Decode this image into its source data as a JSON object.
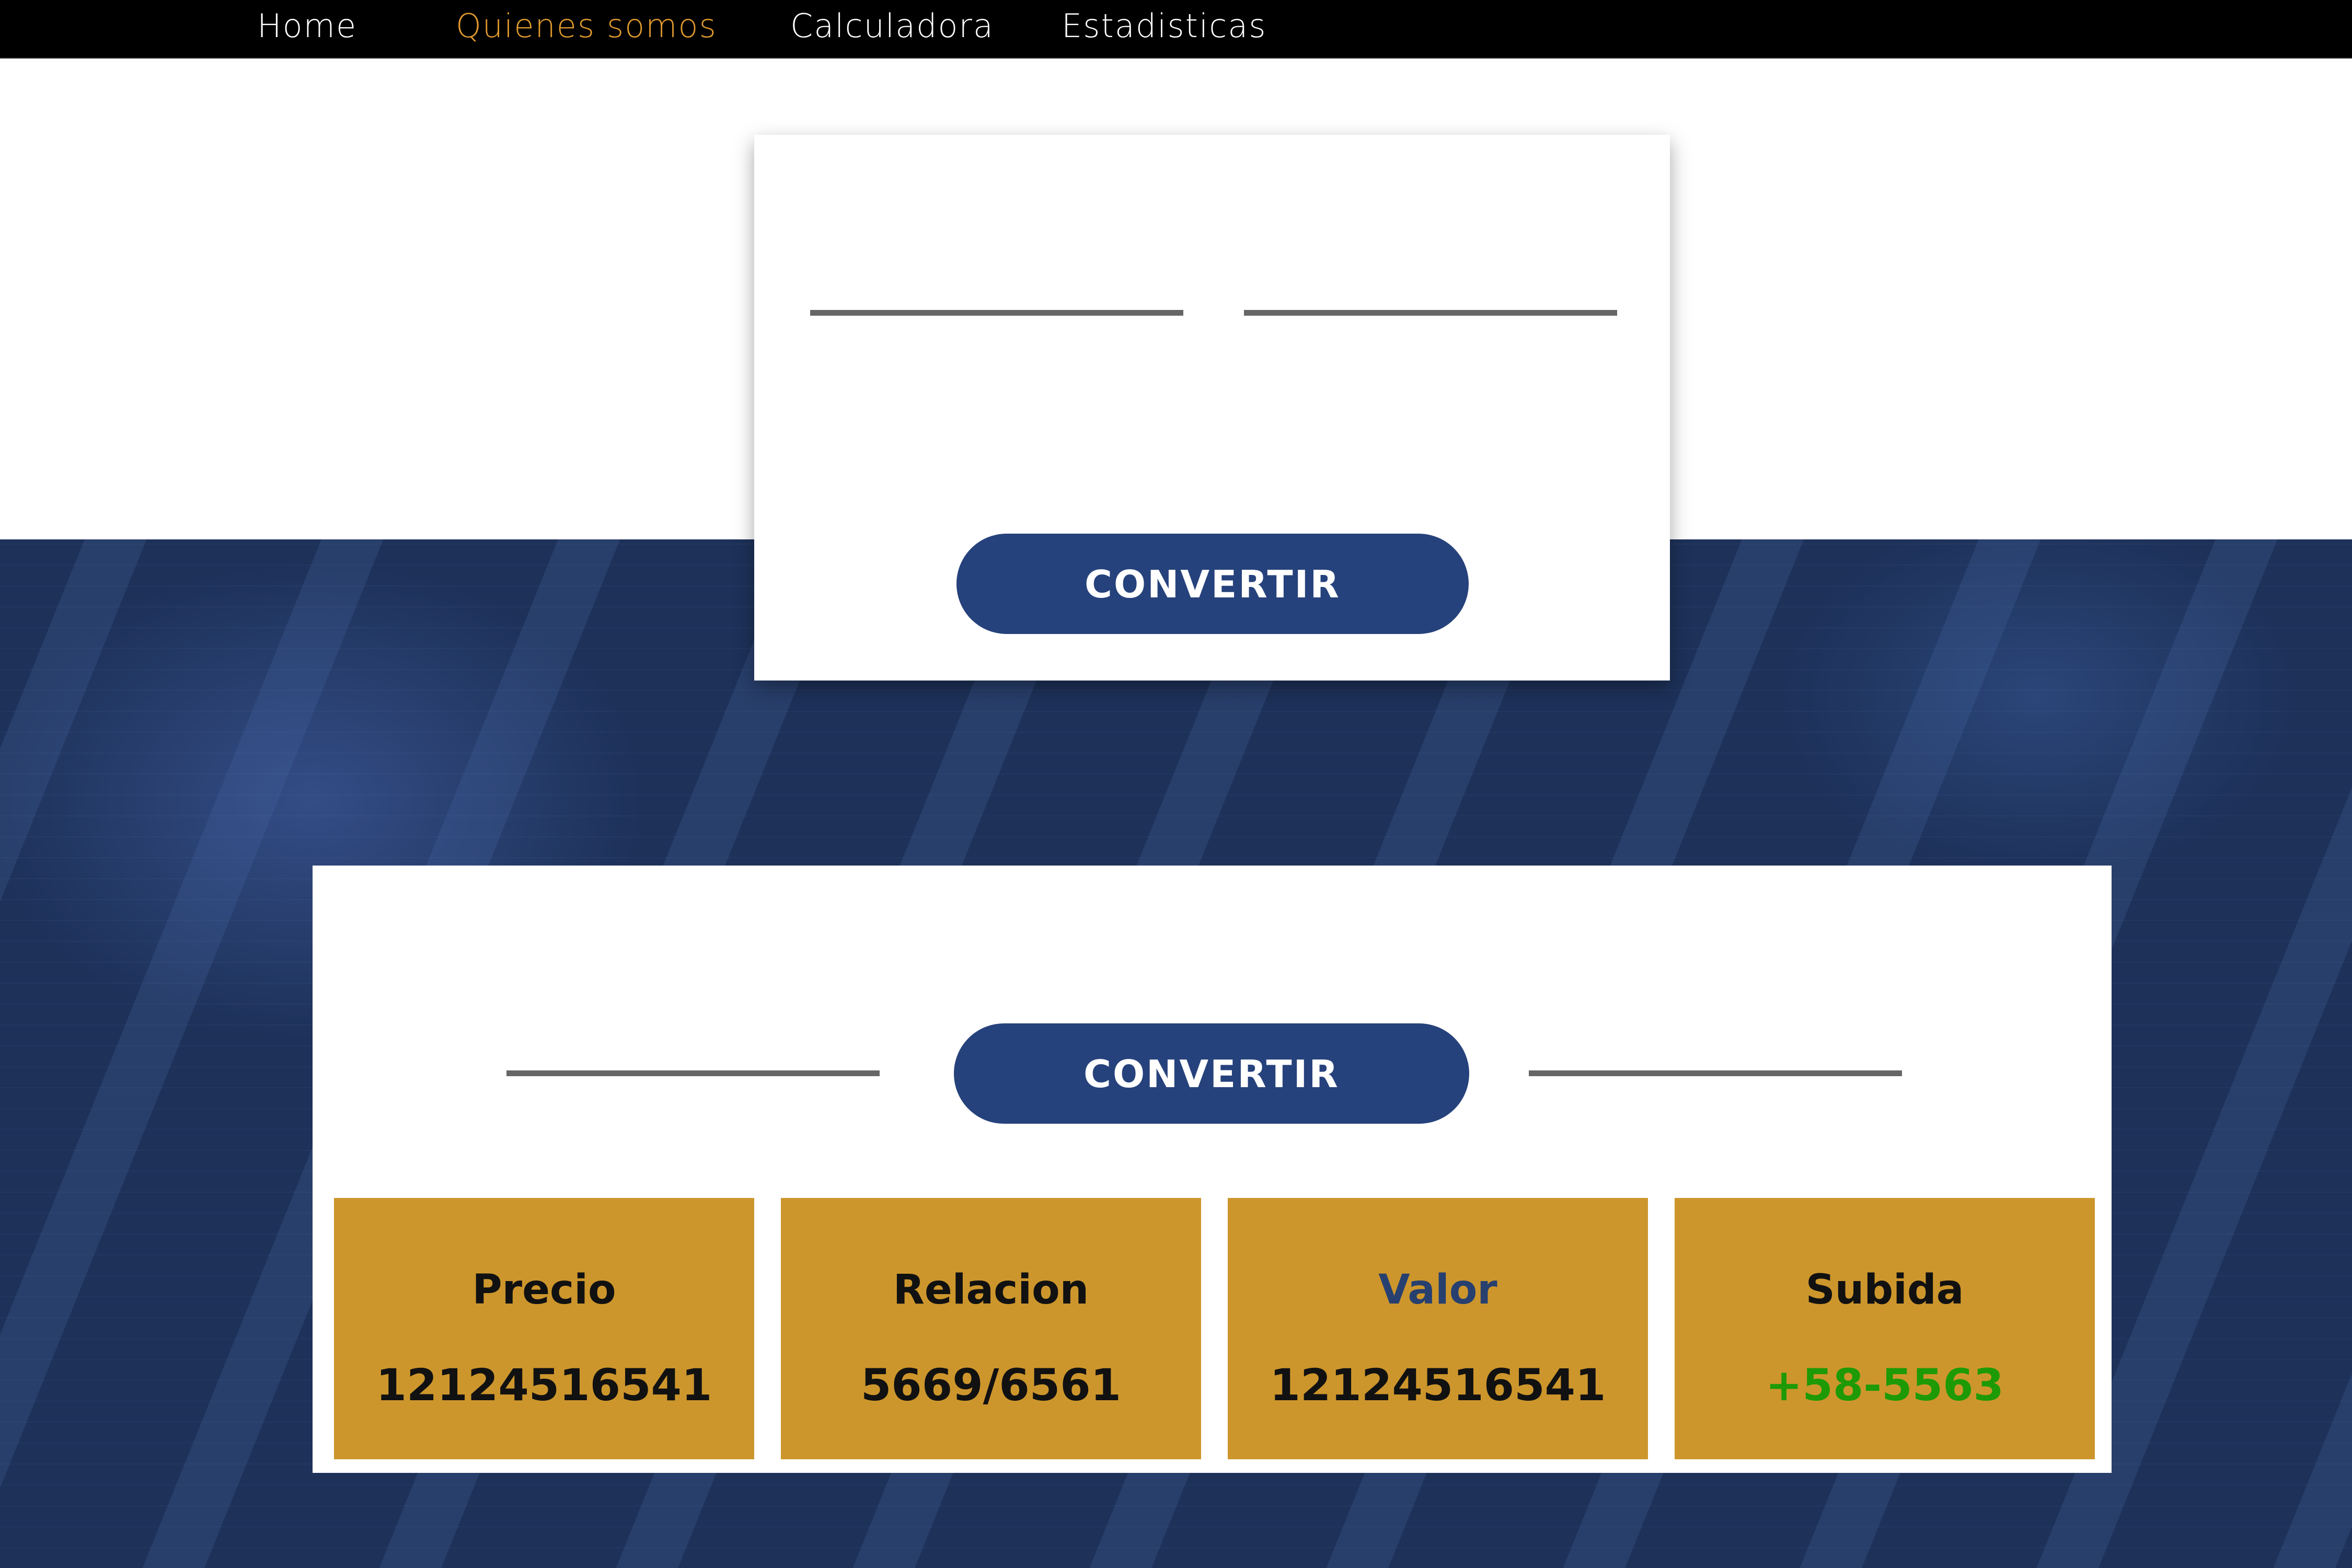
{
  "nav": {
    "items": [
      {
        "label": "Home"
      },
      {
        "label": "Quienes somos"
      },
      {
        "label": "Calculadora"
      },
      {
        "label": "Estadisticas"
      }
    ],
    "active_color": "#e09a2e"
  },
  "converter": {
    "from_value": "",
    "to_value": "",
    "button_label": "CONVERTIR"
  },
  "stats": {
    "from_value": "",
    "to_value": "",
    "button_label": "CONVERTIR",
    "cards": [
      {
        "label": "Precio",
        "value": "12124516541"
      },
      {
        "label": "Relacion",
        "value": "5669/6561"
      },
      {
        "label": "Valor",
        "value": "12124516541"
      },
      {
        "label": "Subida",
        "value": "+58-5563"
      }
    ]
  },
  "colors": {
    "primary_blue": "#26427c",
    "hero_blue": "#1d3159",
    "card_gold": "#cd962c",
    "positive_green": "#1e9a07",
    "accent_label_blue": "#27406f"
  }
}
